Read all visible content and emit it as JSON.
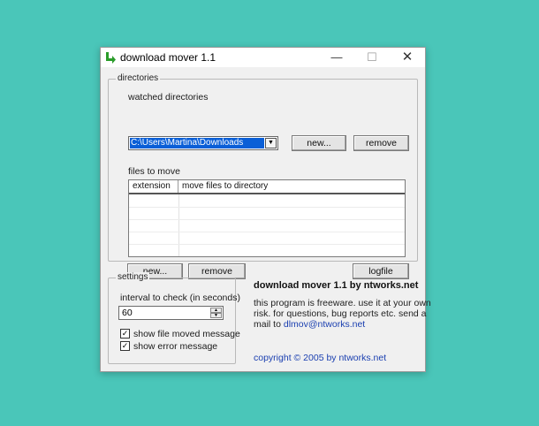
{
  "window": {
    "title": "download mover 1.1",
    "controls": {
      "minimize": "—",
      "maximize": "☐",
      "close": "✕"
    }
  },
  "directories": {
    "legend": "directories",
    "watched_label": "watched directories",
    "watched_value": "C:\\Users\\Martina\\Downloads",
    "new_button": "new...",
    "remove_button": "remove",
    "files_label": "files to move",
    "columns": [
      "extension",
      "move files to directory"
    ],
    "rows": [],
    "files_new_button": "new...",
    "files_remove_button": "remove",
    "logfile_button": "logfile"
  },
  "settings": {
    "legend": "settings",
    "interval_label": "interval to check (in seconds)",
    "interval_value": "60",
    "show_moved_label": "show file moved message",
    "show_moved_checked": true,
    "show_error_label": "show error message",
    "show_error_checked": true
  },
  "about": {
    "title": "download mover 1.1 by ntworks.net",
    "line1": "this program is freeware. use it at your own",
    "line2": "risk. for questions, bug reports etc. send a",
    "line3_prefix": "mail to",
    "email": "dlmov@ntworks.net",
    "copyright": "copyright © 2005 by ntworks.net"
  },
  "colors": {
    "background": "#4ac6b9",
    "window_face": "#f0f0f0",
    "selection": "#0a5fd7",
    "link": "#1a3fb0",
    "app_icon": "#2a9c2a"
  },
  "icons": {
    "app": "download-arrow-icon",
    "dropdown": "triangle-down-icon",
    "check": "check-icon"
  }
}
